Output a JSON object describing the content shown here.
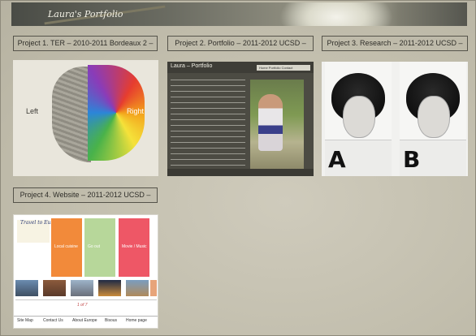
{
  "banner": {
    "title": "Laura's Portfolio"
  },
  "projects": [
    {
      "label": "Project 1. TER – 2010-2011 Bordeaux 2 –",
      "thumb_text_left": "Left",
      "thumb_text_right": "Right"
    },
    {
      "label": "Project 2. Portfolio – 2011-2012 UCSD –",
      "thumb_title": "Laura – Portfolio",
      "thumb_nav": "Home   Portfolio   Contact"
    },
    {
      "label": "Project 3. Research – 2011-2012 UCSD –",
      "panel_a": "A",
      "panel_b": "B"
    },
    {
      "label": "Project 4. Website – 2011-2012 UCSD –",
      "logo": "Travel to Europe",
      "columns": [
        "Local cuisine",
        "Go out",
        "Movie / Music"
      ],
      "pager": "1 of 7",
      "footer": [
        "Site Map",
        "Contact Us",
        "About Europe",
        "Bisous",
        "Home page"
      ]
    }
  ],
  "colors": {
    "accent_orange": "#f28a3a",
    "accent_green": "#b7d79a",
    "accent_red": "#ee5766"
  }
}
